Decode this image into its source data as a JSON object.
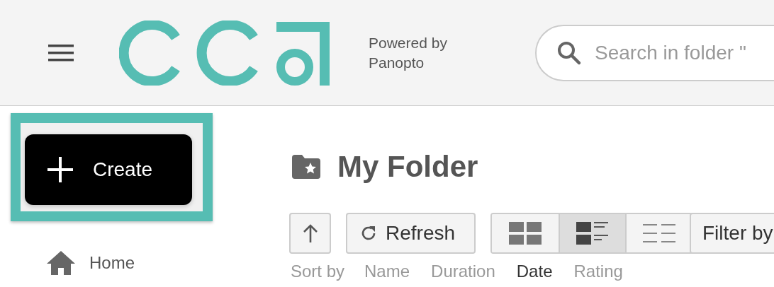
{
  "header": {
    "powered_by": [
      "Powered by",
      "Panopto"
    ],
    "search": {
      "placeholder": "Search in folder \""
    }
  },
  "sidebar": {
    "create_button": {
      "label": "Create",
      "highlighted": true
    },
    "items": [
      {
        "label": "Home",
        "selected": false
      }
    ]
  },
  "main": {
    "title": "My Folder",
    "toolbar": {
      "refresh": "Refresh",
      "views": [
        {
          "kind": "grid",
          "selected": false
        },
        {
          "kind": "detail",
          "selected": true
        },
        {
          "kind": "list",
          "selected": false
        }
      ],
      "filter": "Filter by"
    },
    "sort": {
      "label": "Sort by",
      "options": [
        {
          "label": "Name",
          "selected": false
        },
        {
          "label": "Duration",
          "selected": false
        },
        {
          "label": "Date",
          "selected": true
        },
        {
          "label": "Rating",
          "selected": false
        }
      ]
    }
  }
}
